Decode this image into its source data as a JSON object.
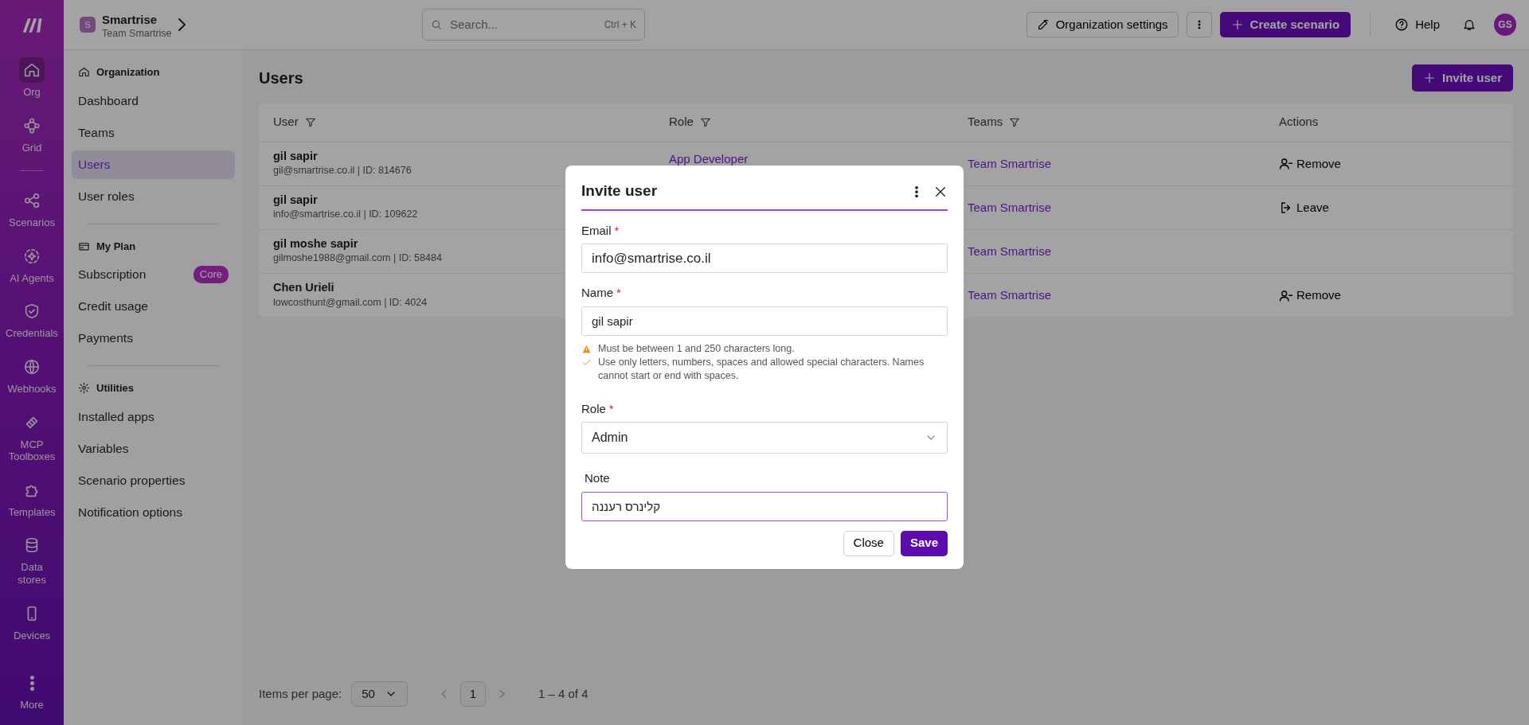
{
  "rail": {
    "items": [
      {
        "label": "Org",
        "selected": true
      },
      {
        "label": "Grid",
        "selected": false
      },
      {
        "label": "Scenarios",
        "selected": false
      },
      {
        "label": "AI Agents",
        "selected": false
      },
      {
        "label": "Credentials",
        "selected": false
      },
      {
        "label": "Webhooks",
        "selected": false
      },
      {
        "label": "MCP Toolboxes",
        "selected": false
      },
      {
        "label": "Templates",
        "selected": false
      },
      {
        "label": "Data stores",
        "selected": false
      },
      {
        "label": "Devices",
        "selected": false
      },
      {
        "label": "More",
        "selected": false
      }
    ]
  },
  "workspace": {
    "initial": "S",
    "name": "Smartrise",
    "team": "Team Smartrise"
  },
  "search": {
    "placeholder": "Search...",
    "shortcut": "Ctrl + K"
  },
  "header": {
    "settings_button": "Organization settings",
    "create_button": "Create scenario",
    "help": "Help",
    "avatar": "GS"
  },
  "sidebar": {
    "sections": [
      {
        "title": "Organization",
        "items": [
          {
            "label": "Dashboard",
            "selected": false
          },
          {
            "label": "Teams",
            "selected": false
          },
          {
            "label": "Users",
            "selected": true
          },
          {
            "label": "User roles",
            "selected": false
          }
        ]
      },
      {
        "title": "My Plan",
        "items": [
          {
            "label": "Subscription",
            "selected": false,
            "badge": "Core"
          },
          {
            "label": "Credit usage",
            "selected": false
          },
          {
            "label": "Payments",
            "selected": false
          }
        ]
      },
      {
        "title": "Utilities",
        "items": [
          {
            "label": "Installed apps",
            "selected": false
          },
          {
            "label": "Variables",
            "selected": false
          },
          {
            "label": "Scenario properties",
            "selected": false
          },
          {
            "label": "Notification options",
            "selected": false
          }
        ]
      }
    ]
  },
  "page": {
    "title": "Users",
    "invite_button": "Invite user"
  },
  "table": {
    "columns": [
      {
        "label": "User",
        "filter": true
      },
      {
        "label": "Role",
        "filter": true
      },
      {
        "label": "Teams",
        "filter": true
      },
      {
        "label": "Actions",
        "filter": false
      }
    ],
    "rows": [
      {
        "name": "gil sapir",
        "detail": "gil@smartrise.co.il | ID: 814676",
        "role": "App Developer",
        "teams": "Team Smartrise",
        "action": {
          "kind": "remove",
          "label": "Remove"
        }
      },
      {
        "name": "gil sapir",
        "detail": "info@smartrise.co.il | ID: 109622",
        "teams": "Team Smartrise",
        "action": {
          "kind": "leave",
          "label": "Leave"
        }
      },
      {
        "name": "gil moshe sapir",
        "detail": "gilmoshe1988@gmail.com | ID: 58484",
        "teams": "Team Smartrise"
      },
      {
        "name": "Chen Urieli",
        "detail": "lowcosthunt@gmail.com | ID: 4024",
        "teams": "Team Smartrise",
        "action": {
          "kind": "remove",
          "label": "Remove"
        }
      }
    ]
  },
  "pagination": {
    "label": "Items per page:",
    "per_page": "50",
    "pages": [
      {
        "label": "1",
        "selected": true
      }
    ],
    "range": "1 – 4 of 4"
  },
  "modal": {
    "title": "Invite user",
    "fields": [
      {
        "kind": "input",
        "label": "Email",
        "required_mark": "*",
        "value": "info@smartrise.co.il",
        "focused": false
      },
      {
        "kind": "input",
        "label": "Name",
        "required_mark": "*",
        "value": "gil sapir",
        "focused": false,
        "hints": [
          {
            "kind": "warning",
            "text": "Must be between 1 and 250 characters long."
          },
          {
            "kind": "ok",
            "text": "Use only letters, numbers, spaces and allowed special characters. Names cannot start or end with spaces."
          }
        ]
      },
      {
        "kind": "select",
        "label": "Role",
        "required_mark": "*",
        "value": "Admin",
        "focused": false
      },
      {
        "kind": "input",
        "label": "Note",
        "value": "קלינרס רעננה",
        "focused": true
      }
    ],
    "buttons": [
      {
        "kind": "secondary",
        "label": "Close"
      },
      {
        "kind": "primary",
        "label": "Save"
      }
    ]
  }
}
